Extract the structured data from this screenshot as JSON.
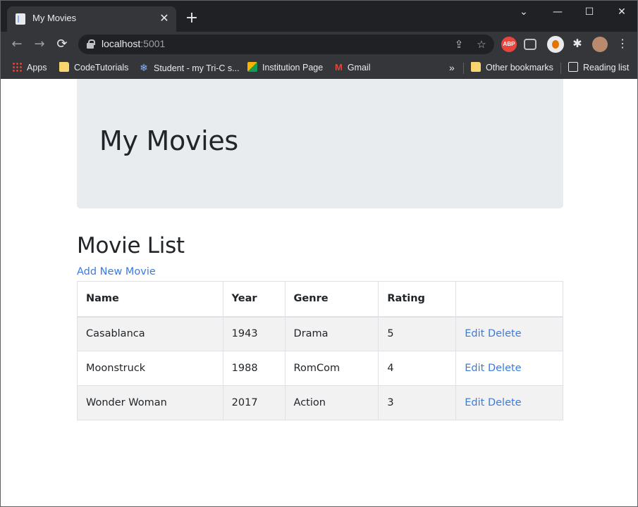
{
  "browser": {
    "tab_title": "My Movies",
    "tab_close": "✕",
    "new_tab": "+",
    "window_controls": {
      "tab_search": "⌄",
      "minimize": "—",
      "maximize": "☐",
      "close": "✕"
    },
    "toolbar": {
      "back": "←",
      "forward": "→",
      "reload": "⟳"
    },
    "url_host": "localhost",
    "url_port": ":5001",
    "omnibox_icons": {
      "share": "⇪",
      "bookmark": "☆"
    },
    "extensions": {
      "abp": "ABP",
      "puzzle": "✱",
      "menu": "⋮"
    },
    "bookmarks": [
      {
        "label": "Apps",
        "icon": "apps-grid-icon"
      },
      {
        "label": "CodeTutorials",
        "icon": "folder-icon"
      },
      {
        "label": "Student - my Tri-C s...",
        "icon": "snowflake-icon"
      },
      {
        "label": "Institution Page",
        "icon": "institution-icon"
      },
      {
        "label": "Gmail",
        "icon": "gmail-icon"
      }
    ],
    "bookmarks_overflow": "»",
    "other_bookmarks": "Other bookmarks",
    "reading_list": "Reading list"
  },
  "page": {
    "jumbotron_title": "My Movies",
    "section_title": "Movie List",
    "add_link": "Add New Movie",
    "table": {
      "headers": [
        "Name",
        "Year",
        "Genre",
        "Rating",
        ""
      ],
      "rows": [
        {
          "name": "Casablanca",
          "year": "1943",
          "genre": "Drama",
          "rating": "5",
          "edit": "Edit",
          "delete": "Delete"
        },
        {
          "name": "Moonstruck",
          "year": "1988",
          "genre": "RomCom",
          "rating": "4",
          "edit": "Edit",
          "delete": "Delete"
        },
        {
          "name": "Wonder Woman",
          "year": "2017",
          "genre": "Action",
          "rating": "3",
          "edit": "Edit",
          "delete": "Delete"
        }
      ]
    }
  },
  "colors": {
    "link": "#3b7be0",
    "jumbotron_bg": "#e9ecef",
    "stripe": "#f2f2f2",
    "chrome_dark": "#202124",
    "chrome_toolbar": "#35363a"
  }
}
